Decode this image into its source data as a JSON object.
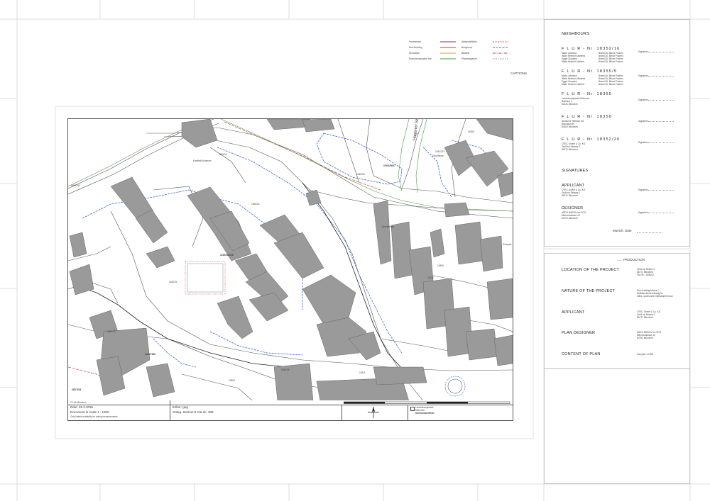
{
  "legend": {
    "items_left": [
      {
        "label": "Precedence",
        "color": "#8a2a8a"
      },
      {
        "label": "New Building",
        "color": "#e03030"
      },
      {
        "label": "Demolition",
        "color": "#e0a020"
      },
      {
        "label": "Road demarcation line",
        "color": "#40a040"
      }
    ],
    "items_right": [
      {
        "label": "Abstandsfläche",
        "color": "#e04040"
      },
      {
        "label": "Baugrenze",
        "color": "#3a6bd8"
      },
      {
        "label": "Baulinie",
        "color": "#d03030"
      },
      {
        "label": "Planteilsgrenze",
        "color": "#777777"
      }
    ],
    "captions_label": "CAPTIONS"
  },
  "neighbours": {
    "title": "NEIGHBOURS",
    "entries": [
      {
        "flur": "F L U R - Nr. 18352/16",
        "lines": [
          "Maria Johanna",
          "Walle Heinrich Manfred",
          "Egger Susanne",
          "Walle Heinrich Norbert"
        ],
        "right": [
          "Brand 26, 86xxx Pusiern",
          "Brand 26, 86xxx Pusiern",
          "Brand 26, 86xxx Pusiern",
          "Brand 26, 86xxx Pusiern"
        ],
        "sig": "Signature"
      },
      {
        "flur": "F L U R - Nr. 18355/5",
        "lines": [
          "Maria Johanna",
          "Walle Heinrich Manfred",
          "Egger Susanne",
          "Walle Heinrich Norbert"
        ],
        "right": [
          "Brand 26, 86xxx Pusiern",
          "Brand 26, 86xxx Pusiern",
          "Brand 26, 86xxx Pusiern",
          "Brand 26, 86xxx Pusiern"
        ],
        "sig": "Signature"
      },
      {
        "flur": "F L U R - Nr. 18355",
        "lines": [
          "Landeshauptstadt München",
          "Rathaus 2",
          "80331 München"
        ],
        "right": [],
        "sig": "Signature"
      },
      {
        "flur": "F L U R - Nr. 18350",
        "lines": [
          "Deutsche Telekom AG",
          "Brauhaus 60",
          "80000 München"
        ],
        "right": [],
        "sig": "Signature"
      },
      {
        "flur": "F L U R - Nr. 18352/20",
        "lines": [
          "OTEC GmbH & Co. KG",
          "Gruft-str Strasse 2",
          "81671 München"
        ],
        "right": [],
        "sig": "Signature"
      }
    ]
  },
  "signatures": {
    "title": "SIGNATURES",
    "applicant_label": "APPLICANT",
    "applicant_lines": [
      "OTEC GmbH & Co. KG",
      "Gruft-str Strasse 2",
      "81671 München"
    ],
    "designer_label": "DESIGNER",
    "designer_lines": [
      "ARDE MAROV inc SCO",
      "Mitrovicstrasse 40",
      "80791 München"
    ],
    "sig": "Signature",
    "date_label": "Munich, Date"
  },
  "production": {
    "title": "...... PRODUCTION",
    "rows": [
      {
        "label": "LOCATION OF THE PROJECT",
        "lines": [
          "Gruft-str Straße 4",
          "81671 München",
          "Flur Nr.: 18352/2"
        ]
      },
      {
        "label": "NATURE OF THE PROJECT",
        "lines": [
          "New building blocks 2",
          "Multifunctional building for",
          "office, sports and entertainment use"
        ]
      },
      {
        "label": "APPLICANT",
        "lines": [
          "OTEC GmbH & Co. KG",
          "Gruft-str Strasse 2",
          "81671 München"
        ]
      },
      {
        "label": "PLAN DESIGNER",
        "lines": [
          "ARDE MAROV inc SCO",
          "Mitrovicstrasse 40",
          "80791 München"
        ]
      },
      {
        "label": "CONTENT OF PLAN",
        "lines": [
          "Site plan 1:1000"
        ]
      }
    ]
  },
  "map": {
    "street_name": "Hagener Str.",
    "labels": {
      "karlsfeld": "Karlsfeld Museum",
      "sportanlage": "Sportanlage",
      "gruenflaeche": "Grünfläche",
      "schopek": "Schopek",
      "lot_main": "12360/23038",
      "lot_left": "1823/7685",
      "lot_bottomleft": "635/7628",
      "lot_top": "0795/25067",
      "lot_a": "16302/4",
      "lot_b": "16302/8",
      "lot_c": "16302/4",
      "lot_d": "16302/12",
      "lot_e": "16308",
      "lot_f": "16310",
      "lot_g": "16350",
      "lot_h": "16302/1",
      "lot_i": "16302/3",
      "lot_j": "16302/5",
      "lot_k": "16304",
      "lot_l": "16311",
      "lot_m": "16502/14"
    }
  },
  "titleblock": {
    "source": "© LVA München",
    "date": "Date: 25.2.2015",
    "scale": "Document in scale 1 : 1000",
    "note": "Only limited suitability for taking measurements",
    "editor": "Editor: geg",
    "section": "Gmkg. Section 9 Cat.sh. 308",
    "agency_1": "Landeshauptstadt",
    "agency_2": "München",
    "agency_3": "Kommunalreferat"
  }
}
